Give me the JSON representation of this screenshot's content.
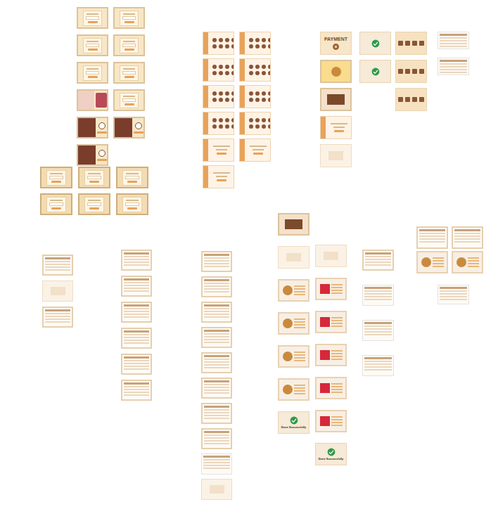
{
  "groups": [
    {
      "frames": [
        {
          "kind": "form"
        },
        {
          "kind": "form"
        },
        {
          "kind": "form"
        },
        {
          "kind": "form"
        },
        {
          "kind": "form"
        },
        {
          "kind": "form"
        },
        {
          "kind": "promo"
        },
        {
          "kind": "form"
        },
        {
          "kind": "photo"
        },
        {
          "kind": "photo"
        },
        {
          "kind": "photo"
        }
      ]
    },
    {
      "frames": [
        {
          "kind": "form-dark"
        },
        {
          "kind": "form-dark"
        },
        {
          "kind": "form-dark"
        },
        {
          "kind": "form-dark"
        },
        {
          "kind": "form-dark"
        },
        {
          "kind": "form-dark"
        }
      ]
    },
    {
      "frames": [
        {
          "kind": "menu"
        },
        {
          "kind": "menu"
        },
        {
          "kind": "menu"
        },
        {
          "kind": "menu"
        },
        {
          "kind": "menu"
        },
        {
          "kind": "menu"
        },
        {
          "kind": "menu"
        },
        {
          "kind": "menu"
        },
        {
          "kind": "checkout"
        },
        {
          "kind": "checkout"
        },
        {
          "kind": "checkout"
        }
      ]
    },
    {
      "frames": [
        {
          "kind": "payment",
          "title": "PAYMENT"
        },
        {
          "kind": "cake"
        },
        {
          "kind": "brand"
        },
        {
          "kind": "checkout"
        },
        {
          "kind": "blank"
        }
      ]
    },
    {
      "frames": [
        {
          "kind": "success"
        },
        {
          "kind": "success"
        }
      ]
    },
    {
      "frames": [
        {
          "kind": "products"
        },
        {
          "kind": "products"
        },
        {
          "kind": "products"
        }
      ]
    },
    {
      "frames": [
        {
          "kind": "doc"
        },
        {
          "kind": "doc"
        }
      ]
    },
    {
      "frames": [
        {
          "kind": "table"
        },
        {
          "kind": "blank"
        },
        {
          "kind": "table"
        }
      ]
    },
    {
      "frames": [
        {
          "kind": "table"
        },
        {
          "kind": "table"
        },
        {
          "kind": "table"
        },
        {
          "kind": "table"
        },
        {
          "kind": "table"
        },
        {
          "kind": "table"
        }
      ]
    },
    {
      "frames": [
        {
          "kind": "table"
        },
        {
          "kind": "table"
        },
        {
          "kind": "table"
        },
        {
          "kind": "table"
        },
        {
          "kind": "table"
        },
        {
          "kind": "table"
        },
        {
          "kind": "table"
        },
        {
          "kind": "table"
        },
        {
          "kind": "doc"
        },
        {
          "kind": "blank"
        }
      ]
    },
    {
      "frames": [
        {
          "kind": "brand"
        },
        {
          "kind": "blank"
        },
        {
          "kind": "cookie"
        },
        {
          "kind": "cookie"
        },
        {
          "kind": "cookie"
        },
        {
          "kind": "cookie"
        },
        {
          "kind": "success",
          "caption": "Done Successfully"
        }
      ]
    },
    {
      "frames": [
        {
          "kind": "blank"
        },
        {
          "kind": "redbox"
        },
        {
          "kind": "redbox"
        },
        {
          "kind": "redbox"
        },
        {
          "kind": "redbox"
        },
        {
          "kind": "redbox"
        },
        {
          "kind": "success",
          "caption": "Done Successfully"
        }
      ]
    },
    {
      "frames": [
        {
          "kind": "profile"
        },
        {
          "kind": "doc"
        },
        {
          "kind": "doc"
        },
        {
          "kind": "doc"
        }
      ]
    },
    {
      "frames": [
        {
          "kind": "table"
        },
        {
          "kind": "table"
        },
        {
          "kind": "cookie"
        },
        {
          "kind": "cookie"
        }
      ]
    },
    {
      "frames": [
        {
          "kind": "doc"
        }
      ]
    }
  ]
}
